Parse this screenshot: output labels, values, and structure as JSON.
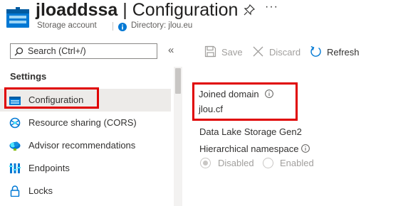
{
  "header": {
    "resource_name": "jloaddssa",
    "separator": "|",
    "page_name": "Configuration",
    "more_label": "···",
    "resource_type": "Storage account",
    "directory_label": "Directory: jlou.eu"
  },
  "sidebar": {
    "search_placeholder": "Search (Ctrl+/)",
    "collapse_label": "«",
    "section_title": "Settings",
    "items": [
      {
        "label": "Configuration",
        "icon": "configuration-icon",
        "selected": true
      },
      {
        "label": "Resource sharing (CORS)",
        "icon": "cors-icon",
        "selected": false
      },
      {
        "label": "Advisor recommendations",
        "icon": "advisor-icon",
        "selected": false
      },
      {
        "label": "Endpoints",
        "icon": "endpoints-icon",
        "selected": false
      },
      {
        "label": "Locks",
        "icon": "lock-icon",
        "selected": false
      }
    ]
  },
  "toolbar": {
    "save_label": "Save",
    "discard_label": "Discard",
    "refresh_label": "Refresh"
  },
  "content": {
    "joined_domain_label": "Joined domain",
    "joined_domain_value": "jlou.cf",
    "adls_title": "Data Lake Storage Gen2",
    "hns_label": "Hierarchical namespace",
    "hns_options": [
      "Disabled",
      "Enabled"
    ],
    "hns_selected": "Disabled"
  },
  "colors": {
    "accent": "#0078d4",
    "highlight_box": "#e00000",
    "selected_bg": "#edebe9",
    "disabled_text": "#a19f9d"
  }
}
